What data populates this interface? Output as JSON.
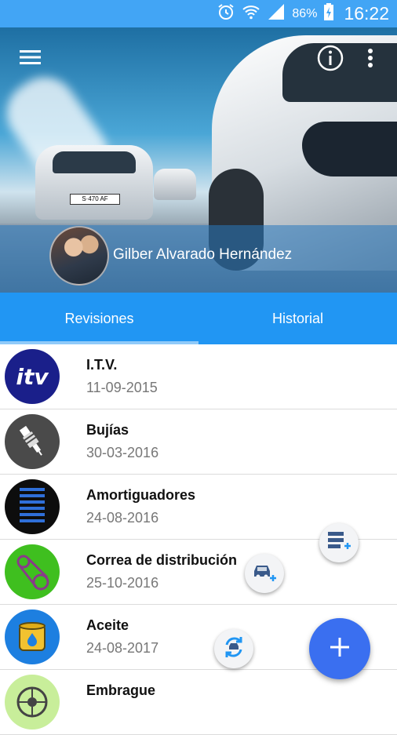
{
  "status_bar": {
    "battery_percent": "86%",
    "time": "16:22",
    "icons": [
      "alarm-icon",
      "wifi-icon",
      "signal-icon",
      "battery-charging-icon"
    ]
  },
  "header": {
    "user_name": "Gilber Alvarado Hernández",
    "hero_plate_text": "S·470 AF",
    "icons": [
      "menu-icon",
      "info-icon",
      "more-vert-icon"
    ]
  },
  "tabs": [
    {
      "label": "Revisiones",
      "selected": true
    },
    {
      "label": "Historial",
      "selected": false
    }
  ],
  "items": [
    {
      "title": "I.T.V.",
      "date": "11-09-2015",
      "icon": "itv-logo",
      "icon_text": "itv",
      "color": "#1a1f8a"
    },
    {
      "title": "Bujías",
      "date": "30-03-2016",
      "icon": "spark-plug-icon",
      "color": "#4a4a4a"
    },
    {
      "title": "Amortiguadores",
      "date": "24-08-2016",
      "icon": "shock-absorber-icon",
      "color": "#0d0d0d"
    },
    {
      "title": "Correa de distribución",
      "date": "25-10-2016",
      "icon": "timing-belt-icon",
      "color": "#3fbf1f"
    },
    {
      "title": "Aceite",
      "date": "24-08-2017",
      "icon": "oil-can-icon",
      "color": "#1d7fe0"
    },
    {
      "title": "Embrague",
      "date": "",
      "icon": "clutch-icon",
      "color": "#c8ee9a"
    }
  ],
  "fabs": {
    "main": "add-icon",
    "mini": [
      "add-list-icon",
      "add-car-icon",
      "sync-icon"
    ]
  },
  "colors": {
    "status_bar": "#42a5f5",
    "tab_bar": "#2196f3",
    "fab": "#3a6ff0"
  }
}
